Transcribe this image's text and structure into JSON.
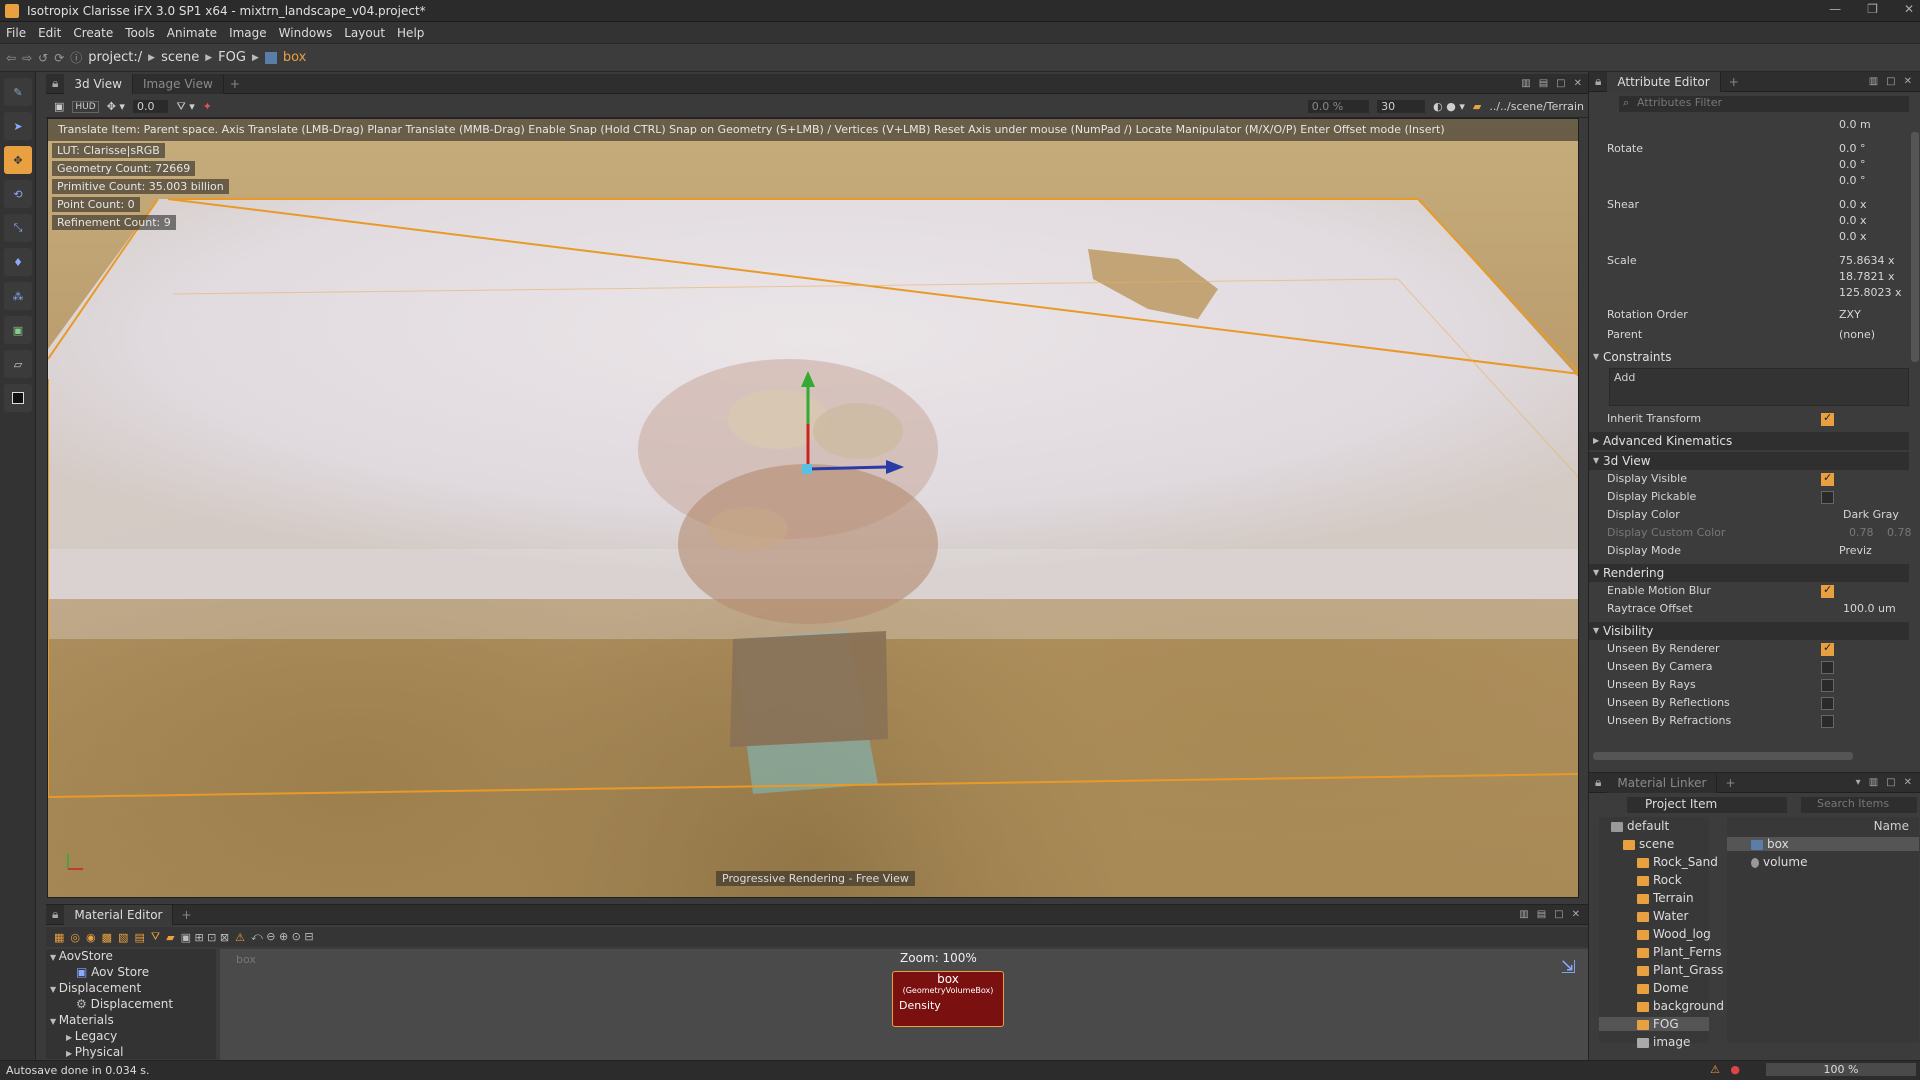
{
  "window": {
    "title": "Isotropix Clarisse iFX 3.0 SP1 x64 - mixtrn_landscape_v04.project*"
  },
  "menu": [
    "File",
    "Edit",
    "Create",
    "Tools",
    "Animate",
    "Image",
    "Windows",
    "Layout",
    "Help"
  ],
  "breadcrumb": [
    "project:/",
    "scene",
    "FOG",
    "box"
  ],
  "view_tabs": {
    "active": "3d View",
    "inactive": "Image View"
  },
  "viewport_toolbar": {
    "hud": "HUD",
    "value": "0.0",
    "pct": "0.0 %",
    "frames": "30",
    "path": "../../scene/Terrain"
  },
  "hud": {
    "hint": "Translate Item: Parent space. Axis Translate (LMB-Drag)  Planar Translate (MMB-Drag)  Enable Snap (Hold CTRL)  Snap on Geometry (S+LMB) / Vertices (V+LMB)  Reset Axis under mouse (NumPad /)  Locate Manipulator (M/X/O/P)  Enter Offset mode (Insert)",
    "lut": "LUT: Clarisse|sRGB",
    "geometry": "Geometry Count: 72669",
    "primitive": "Primitive Count: 35.003 billion",
    "point": "Point Count: 0",
    "refinement": "Refinement Count: 9",
    "progress": "Progressive Rendering - Free View"
  },
  "attribute_editor": {
    "tab": "Attribute Editor",
    "filter_placeholder": "Attributes Filter",
    "top_value": "0.0 m",
    "rotate_label": "Rotate",
    "rotate": [
      "0.0 °",
      "0.0 °",
      "0.0 °"
    ],
    "shear_label": "Shear",
    "shear": [
      "0.0 x",
      "0.0 x",
      "0.0 x"
    ],
    "scale_label": "Scale",
    "scale": [
      "75.8634 x",
      "18.7821 x",
      "125.8023 x"
    ],
    "rotation_order_label": "Rotation Order",
    "rotation_order": "ZXY",
    "parent_label": "Parent",
    "parent": "(none)",
    "constraints": "Constraints",
    "add": "Add",
    "inherit_transform": "Inherit Transform",
    "advanced_kinematics": "Advanced Kinematics",
    "view3d": "3d View",
    "display_visible": "Display Visible",
    "display_pickable": "Display Pickable",
    "display_color_label": "Display Color",
    "display_color": "Dark Gray",
    "display_custom_color_label": "Display Custom Color",
    "custom_color": [
      "0.78",
      "0.78"
    ],
    "display_mode_label": "Display Mode",
    "display_mode": "Previz",
    "rendering": "Rendering",
    "motion_blur": "Enable Motion Blur",
    "raytrace_offset_label": "Raytrace Offset",
    "raytrace_offset": "100.0 um",
    "visibility": "Visibility",
    "unseen_renderer": "Unseen By Renderer",
    "unseen_camera": "Unseen By Camera",
    "unseen_rays": "Unseen By Rays",
    "unseen_reflections": "Unseen By Reflections",
    "unseen_refractions": "Unseen By Refractions"
  },
  "material_linker": {
    "tab": "Material Linker",
    "project_item": "Project Item",
    "search_placeholder": "Search Items",
    "name_header": "Name",
    "tree": [
      "default",
      "scene",
      "Rock_Sand",
      "Rock",
      "Terrain",
      "Water",
      "Wood_log",
      "Plant_Ferns",
      "Plant_Grass",
      "Dome",
      "background",
      "FOG",
      "image"
    ],
    "items": [
      "box",
      "volume"
    ]
  },
  "material_editor": {
    "tab": "Material Editor",
    "tree": [
      "AovStore",
      "Aov Store",
      "Displacement",
      "Displacement",
      "Materials",
      "Legacy",
      "Physical"
    ],
    "zoom": "Zoom: 100%",
    "context": "box",
    "node_title": "box",
    "node_type": "(GeometryVolumeBox)",
    "node_port": "Density"
  },
  "status": {
    "message": "Autosave done in 0.034 s.",
    "zoom": "100 %"
  },
  "colors": {
    "accent": "#e8a040",
    "node": "#7a1010"
  }
}
